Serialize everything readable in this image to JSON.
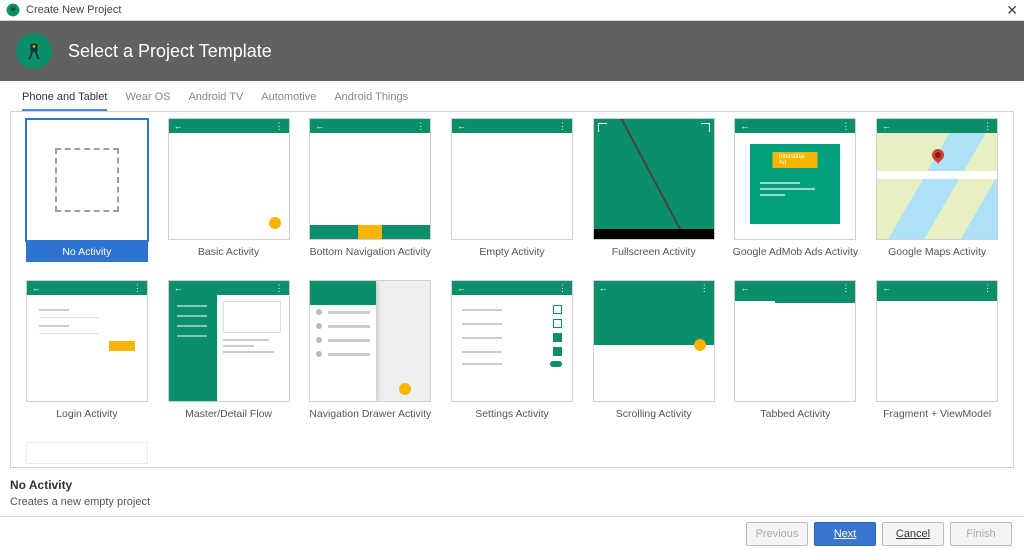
{
  "window": {
    "title": "Create New Project",
    "close": "✕"
  },
  "header": {
    "title": "Select a Project Template"
  },
  "tabs": [
    "Phone and Tablet",
    "Wear OS",
    "Android TV",
    "Automotive",
    "Android Things"
  ],
  "templates": [
    "No Activity",
    "Basic Activity",
    "Bottom Navigation Activity",
    "Empty Activity",
    "Fullscreen Activity",
    "Google AdMob Ads Activity",
    "Google Maps Activity",
    "Login Activity",
    "Master/Detail Flow",
    "Navigation Drawer Activity",
    "Settings Activity",
    "Scrolling Activity",
    "Tabbed Activity",
    "Fragment + ViewModel"
  ],
  "selected": {
    "title": "No Activity",
    "description": "Creates a new empty project"
  },
  "buttons": {
    "previous": "Previous",
    "next": "Next",
    "cancel": "Cancel",
    "finish": "Finish"
  },
  "admob_label": "Interstitial Ad"
}
